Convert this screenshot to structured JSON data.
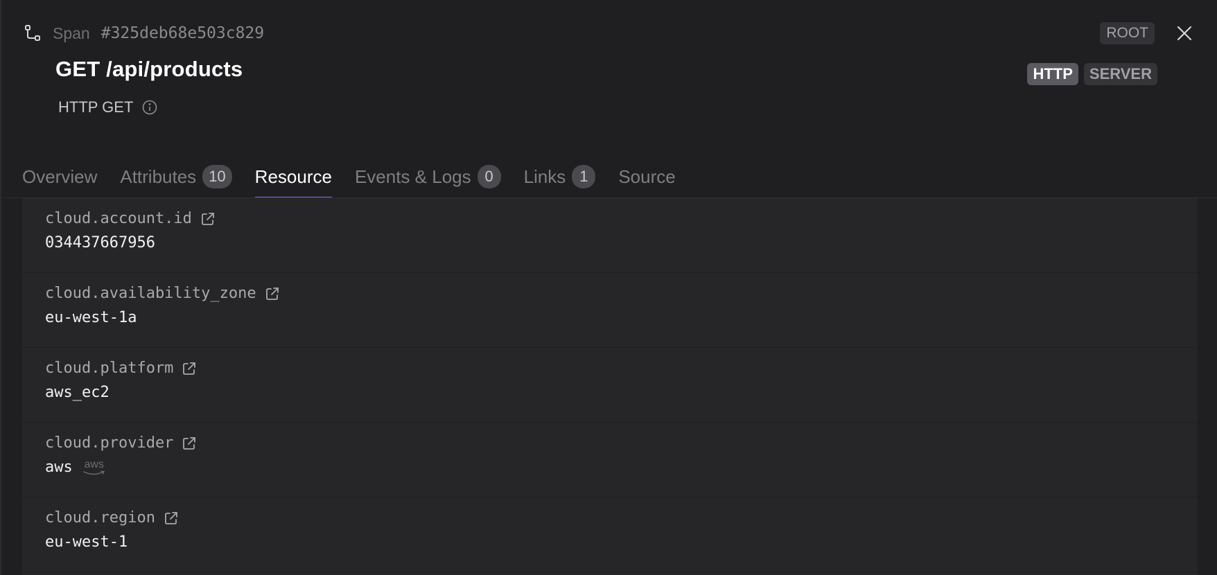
{
  "header": {
    "kind": "Span",
    "span_id": "#325deb68e503c829",
    "root_label": "ROOT",
    "title": "GET /api/products",
    "subtitle": "HTTP GET",
    "badges": [
      "HTTP",
      "SERVER"
    ]
  },
  "tabs": [
    {
      "label": "Overview",
      "count": null,
      "active": false
    },
    {
      "label": "Attributes",
      "count": "10",
      "active": false
    },
    {
      "label": "Resource",
      "count": null,
      "active": true
    },
    {
      "label": "Events & Logs",
      "count": "0",
      "active": false
    },
    {
      "label": "Links",
      "count": "1",
      "active": false
    },
    {
      "label": "Source",
      "count": null,
      "active": false
    }
  ],
  "resources": [
    {
      "key": "cloud.account.id",
      "value": "034437667956"
    },
    {
      "key": "cloud.availability_zone",
      "value": "eu-west-1a"
    },
    {
      "key": "cloud.platform",
      "value": "aws_ec2"
    },
    {
      "key": "cloud.provider",
      "value": "aws",
      "logo_text": "aws"
    },
    {
      "key": "cloud.region",
      "value": "eu-west-1"
    }
  ],
  "colors": {
    "background": "#1f1f21",
    "list_background": "#262628",
    "active_tab_underline": "#7b6bd9"
  },
  "icons": {
    "span": "span-tree-icon",
    "close": "close-icon",
    "info": "info-icon",
    "external": "external-link-icon",
    "aws": "aws-logo"
  }
}
